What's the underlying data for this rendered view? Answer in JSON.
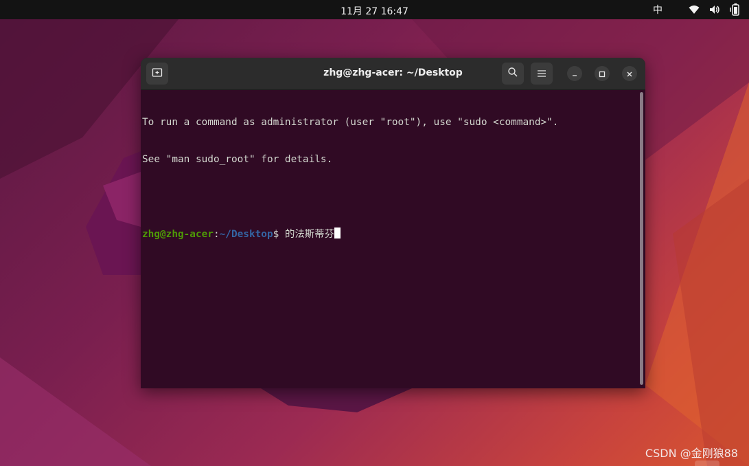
{
  "topbar": {
    "clock": "11月 27  16:47",
    "input_method": "中",
    "icons": [
      "wifi-icon",
      "volume-icon",
      "battery-icon"
    ]
  },
  "window": {
    "title": "zhg@zhg-acer: ~/Desktop",
    "buttons": [
      "new-tab-icon",
      "search-icon",
      "menu-icon",
      "minimize-icon",
      "maximize-icon",
      "close-icon"
    ]
  },
  "terminal": {
    "line1": "To run a command as administrator (user \"root\"), use \"sudo <command>\".",
    "line2": "See \"man sudo_root\" for details.",
    "prompt_user": "zhg@zhg-acer",
    "prompt_colon": ":",
    "prompt_path": "~/Desktop",
    "prompt_symbol": "$ ",
    "input": "的法斯蒂芬"
  },
  "watermark": "CSDN @金刚狼88",
  "colors": {
    "terminal_bg": "#300a24",
    "prompt_user": "#4e9a06",
    "prompt_path": "#3465a4",
    "headerbar": "#2c2c2c"
  }
}
